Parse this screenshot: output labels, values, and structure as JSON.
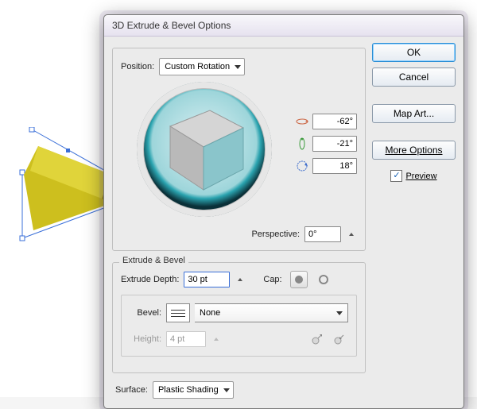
{
  "dialog": {
    "title": "3D Extrude & Bevel Options",
    "position": {
      "label": "Position:",
      "value": "Custom Rotation"
    },
    "rotation": {
      "x": "-62°",
      "y": "-21°",
      "z": "18°"
    },
    "perspective": {
      "label": "Perspective:",
      "value": "0°"
    }
  },
  "extrude": {
    "legend": "Extrude & Bevel",
    "depth": {
      "label": "Extrude Depth:",
      "value": "30 pt"
    },
    "cap": {
      "label": "Cap:"
    },
    "bevel": {
      "label": "Bevel:",
      "value": "None"
    },
    "height": {
      "label": "Height:",
      "value": "4 pt"
    }
  },
  "surface": {
    "label": "Surface:",
    "value": "Plastic Shading"
  },
  "buttons": {
    "ok": "OK",
    "cancel": "Cancel",
    "map_art": "Map Art...",
    "more_options": "More Options"
  },
  "preview": {
    "label": "Preview",
    "checked": true
  }
}
